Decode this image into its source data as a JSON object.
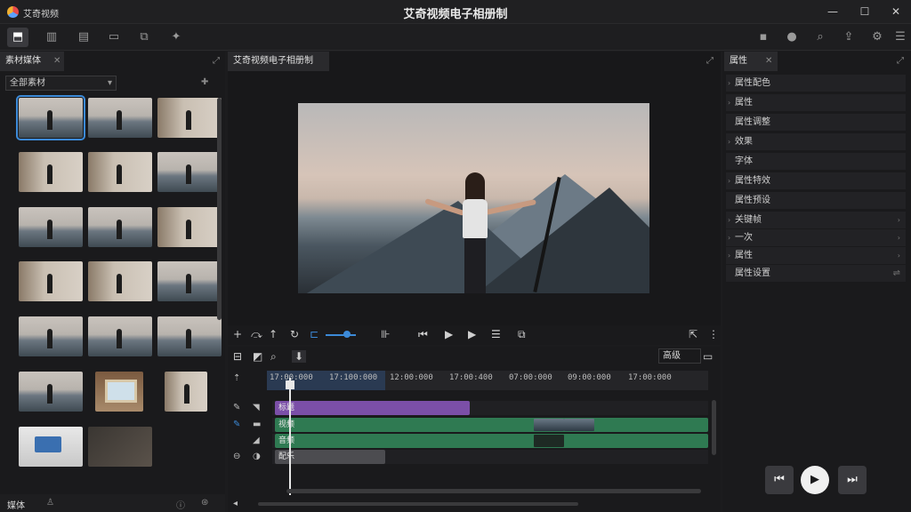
{
  "window": {
    "app_name": "艾奇视频",
    "title": "艾奇视频电子相册制",
    "minimize": "—",
    "maximize": "☐",
    "close": "✕"
  },
  "toolbar": {
    "left_icons": [
      "import-icon",
      "audio-icon",
      "book-icon",
      "folder-icon",
      "export-icon",
      "effects-icon"
    ],
    "right_icons": [
      "record-icon",
      "voice-icon",
      "search-icon",
      "share-icon",
      "settings-icon",
      "menu-icon"
    ]
  },
  "media_panel": {
    "tab_label": "素材媒体",
    "filter_value": "全部素材",
    "thumbnail_count": 20,
    "footer_label": "媒体"
  },
  "preview_panel": {
    "tab_label": "艾奇视频电子相册制"
  },
  "timeline": {
    "preset_label": "高级",
    "timecodes": [
      "17:00:000",
      "17:100:000",
      "12:00:000",
      "17:00:400",
      "07:00:000",
      "09:00:000",
      "17:00:000"
    ],
    "tracks": [
      {
        "name": "title-track",
        "clip_label": "标题"
      },
      {
        "name": "video-track",
        "clip_label": "视频"
      },
      {
        "name": "audio-track",
        "clip_label": "音频"
      },
      {
        "name": "music-track",
        "clip_label": "配乐"
      }
    ]
  },
  "properties_panel": {
    "tab_label": "属性",
    "rows": [
      "属性配色",
      "属性",
      "属性调整",
      "效果",
      "字体",
      "属性特效",
      "属性预设",
      "关键帧",
      "一次",
      "属性",
      "属性设置"
    ]
  },
  "player": {
    "prev": "⏮",
    "play": "▶",
    "next": "⏭"
  }
}
